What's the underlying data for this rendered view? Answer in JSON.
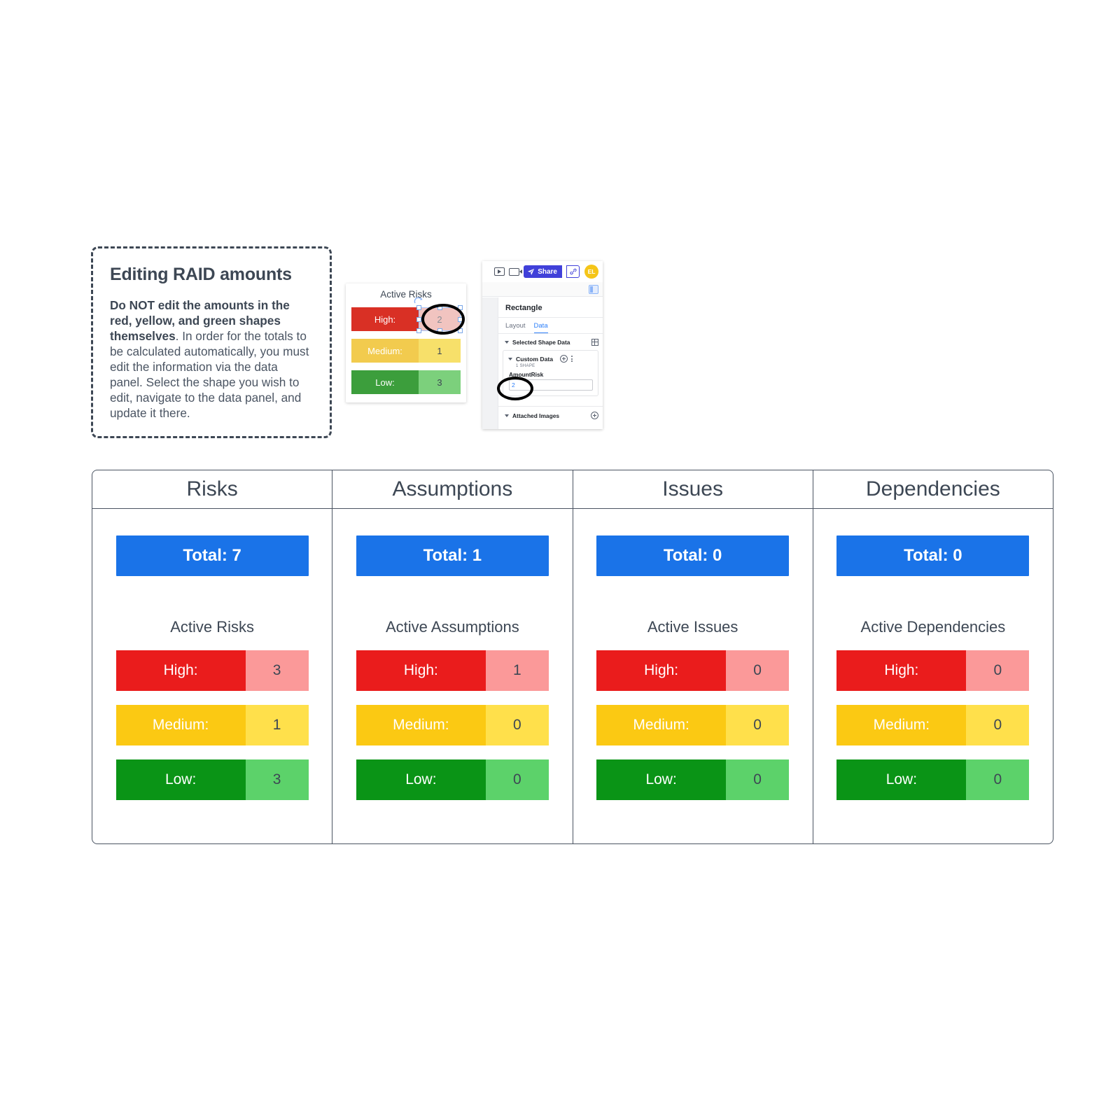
{
  "instruction": {
    "title": "Editing RAID amounts",
    "strong": "Do NOT edit the amounts in the red, yellow, and green shapes themselves",
    "rest": ". In order for the totals to be calculated automatically, you must edit the information via the data panel. Select the shape you wish to edit, navigate to the data panel, and update it there."
  },
  "mini_chart": {
    "title": "Active Risks",
    "rows": [
      {
        "label": "High:",
        "value": "2"
      },
      {
        "label": "Medium:",
        "value": "1"
      },
      {
        "label": "Low:",
        "value": "3"
      }
    ]
  },
  "app_mockup": {
    "share_label": "Share",
    "avatar_initials": "EL",
    "panel_heading": "Rectangle",
    "tabs": [
      {
        "label": "Layout",
        "active": false
      },
      {
        "label": "Data",
        "active": true
      }
    ],
    "selected_shape_data_label": "Selected Shape Data",
    "custom_data_label": "Custom Data",
    "custom_data_sub": "1 SHAPE",
    "field_label": "AmountRisk",
    "field_value": "2",
    "attached_images_label": "Attached Images"
  },
  "raid": {
    "columns": [
      {
        "header": "Risks",
        "total_label": "Total: 7",
        "active_label": "Active Risks",
        "rows": [
          {
            "label": "High:",
            "value": "3"
          },
          {
            "label": "Medium:",
            "value": "1"
          },
          {
            "label": "Low:",
            "value": "3"
          }
        ]
      },
      {
        "header": "Assumptions",
        "total_label": "Total: 1",
        "active_label": "Active Assumptions",
        "rows": [
          {
            "label": "High:",
            "value": "1"
          },
          {
            "label": "Medium:",
            "value": "0"
          },
          {
            "label": "Low:",
            "value": "0"
          }
        ]
      },
      {
        "header": "Issues",
        "total_label": "Total: 0",
        "active_label": "Active Issues",
        "rows": [
          {
            "label": "High:",
            "value": "0"
          },
          {
            "label": "Medium:",
            "value": "0"
          },
          {
            "label": "Low:",
            "value": "0"
          }
        ]
      },
      {
        "header": "Dependencies",
        "total_label": "Total: 0",
        "active_label": "Active Dependencies",
        "rows": [
          {
            "label": "High:",
            "value": "0"
          },
          {
            "label": "Medium:",
            "value": "0"
          },
          {
            "label": "Low:",
            "value": "0"
          }
        ]
      }
    ]
  },
  "colors": {
    "total_blue": "#1a73e8",
    "high_red": "#ea1c1c",
    "high_red_light": "#fb9999",
    "medium_yellow": "#fbc913",
    "medium_yellow_light": "#ffe04b",
    "low_green": "#0a9416",
    "low_green_light": "#5cd26a",
    "ink": "#3d4754",
    "share_blue": "#4040d9",
    "avatar_yellow": "#f5c518"
  }
}
